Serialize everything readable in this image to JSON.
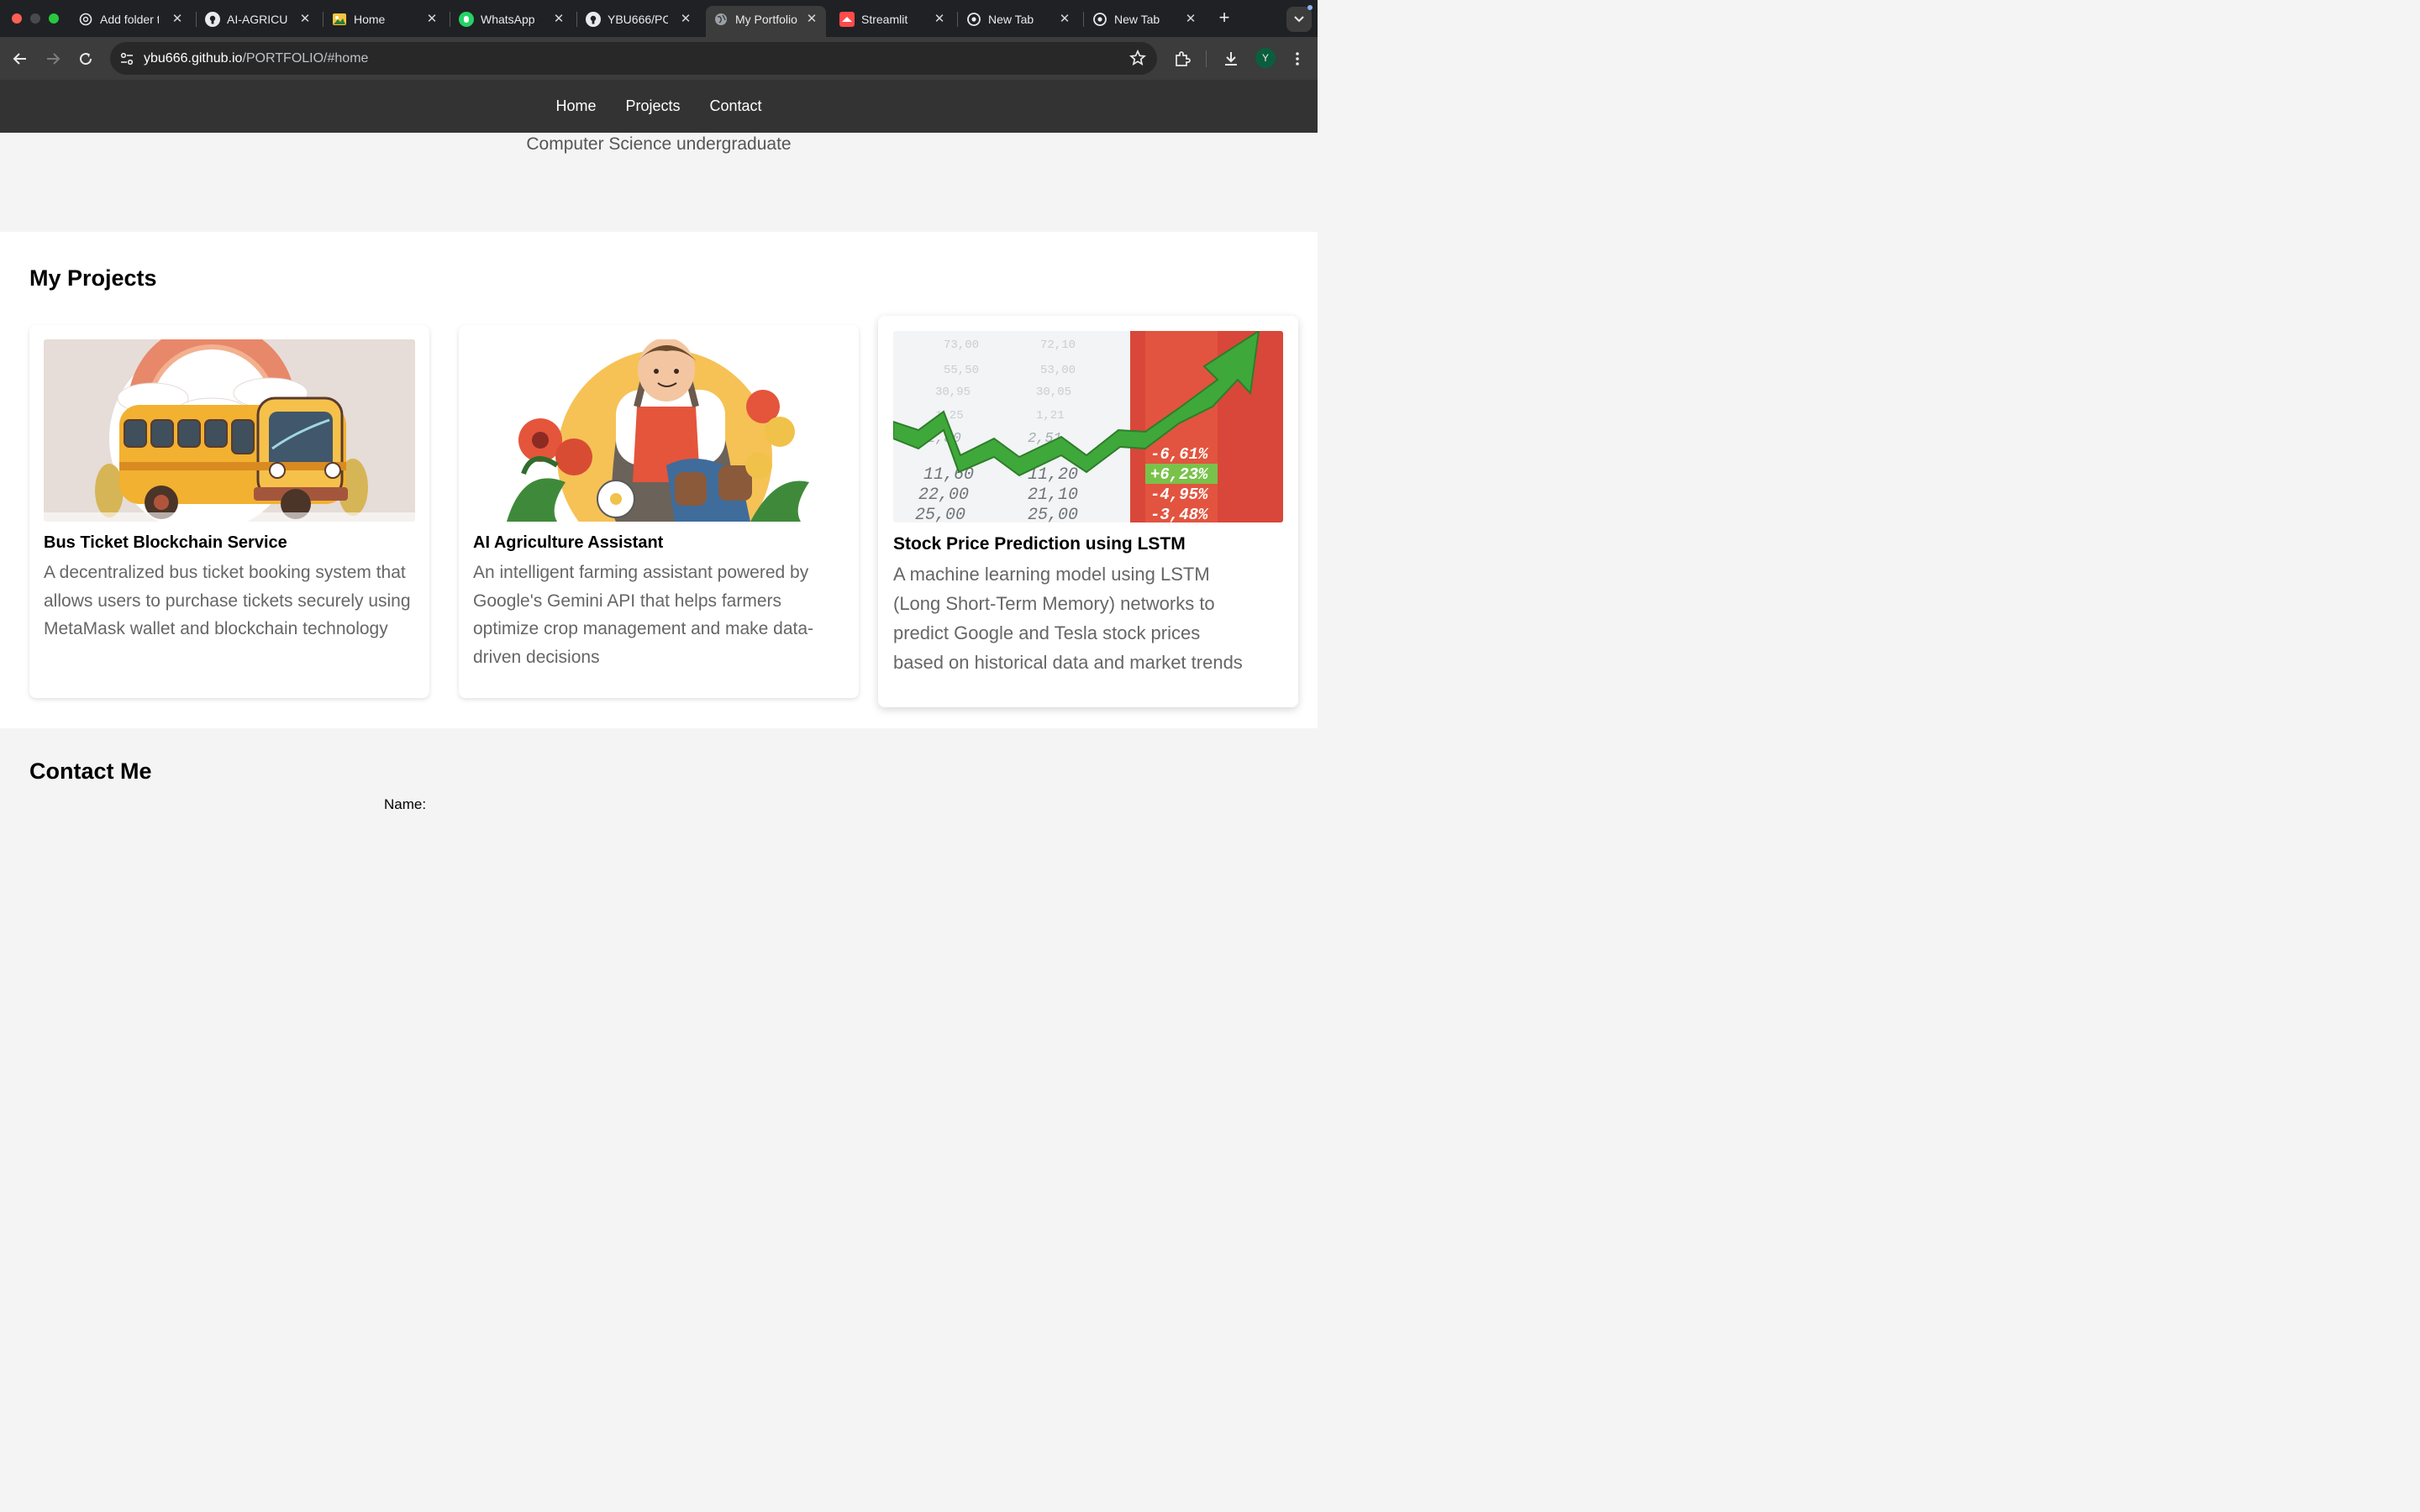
{
  "browser": {
    "tabs": [
      {
        "title": "Add folder t",
        "icon": "openai-icon"
      },
      {
        "title": "AI-AGRICUL",
        "icon": "github-icon"
      },
      {
        "title": "Home",
        "icon": "image-icon"
      },
      {
        "title": "WhatsApp",
        "icon": "whatsapp-icon"
      },
      {
        "title": "YBU666/PC",
        "icon": "github-icon"
      },
      {
        "title": "My Portfolio",
        "icon": "globe-icon"
      },
      {
        "title": "Streamlit",
        "icon": "streamlit-icon"
      },
      {
        "title": "New Tab",
        "icon": "chrome-icon"
      },
      {
        "title": "New Tab",
        "icon": "chrome-icon"
      }
    ],
    "active_tab": "My Portfolio",
    "url_host": "ybu666.github.io",
    "url_path": "/PORTFOLIO/#home",
    "profile_initial": "Y"
  },
  "site": {
    "nav": [
      "Home",
      "Projects",
      "Contact"
    ],
    "hero_subtitle": "Computer Science undergraduate",
    "projects_title": "My Projects",
    "projects": [
      {
        "title": "Bus Ticket Blockchain Service",
        "description": "A decentralized bus ticket booking system that allows users to purchase tickets securely using MetaMask wallet and blockchain technology"
      },
      {
        "title": "AI Agriculture Assistant",
        "description": "An intelligent farming assistant powered by Google's Gemini API that helps farmers optimize crop management and make data-driven decisions"
      },
      {
        "title": "Stock Price Prediction using LSTM",
        "description": "A machine learning model using LSTM (Long Short-Term Memory) networks to predict Google and Tesla stock prices based on historical data and market trends"
      }
    ],
    "contact_title": "Contact Me",
    "contact_name_label": "Name:"
  },
  "stock_image_text": {
    "col1": [
      "11,60",
      "22,00",
      "25,00"
    ],
    "col2": [
      "11,20",
      "21,10",
      "25,00"
    ],
    "col3": [
      "-6,61%",
      "+6,23%",
      "-4,95%",
      "-3,48%"
    ]
  }
}
